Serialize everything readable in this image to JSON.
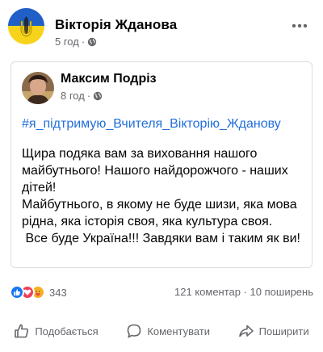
{
  "post": {
    "author": "Вікторія Жданова",
    "time": "5 год",
    "dot": "·"
  },
  "shared": {
    "author": "Максим Подріз",
    "time": "8 год",
    "dot": "·",
    "hashtag": "#я_підтримую_Вчителя_Вікторію_Жданову",
    "text": "Щира подяка вам за виховання нашого майбутнього! Нашого найдорожчого - наших дітей!\nМайбутнього, в якому не буде шизи, яка мова рідна, яка історія своя, яка культура своя.\n Все буде Україна!!! Завдяки вам і таким як ви!"
  },
  "stats": {
    "reactions_count": "343",
    "comments_shares": "121 коментар · 10 поширень"
  },
  "actions": {
    "like": "Подобається",
    "comment": "Коментувати",
    "share": "Поширити"
  },
  "colors": {
    "flag_blue": "#1f5fc7",
    "flag_yellow": "#f7d31c",
    "link": "#216fdb"
  },
  "icons": {
    "globe": "globe-icon",
    "more": "more-icon",
    "like": "thumbs-up-icon",
    "comment": "comment-icon",
    "share": "share-icon"
  }
}
